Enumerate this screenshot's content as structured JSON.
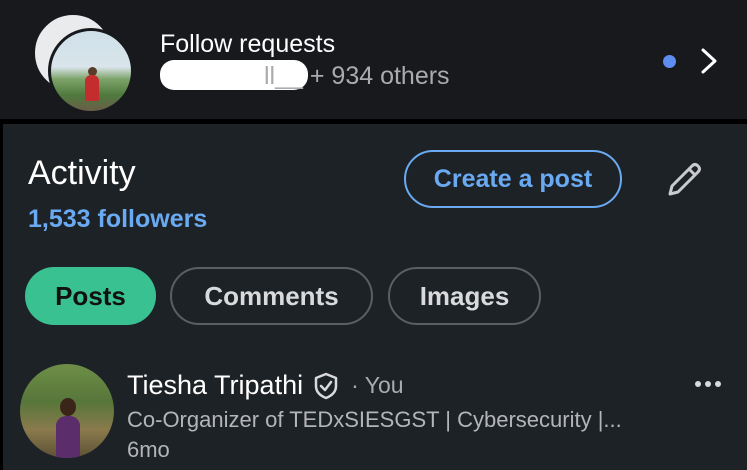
{
  "follow_requests": {
    "title": "Follow requests",
    "name_fragment": "ll__",
    "others_text": " + 934 others",
    "dot_color": "#5e8df0"
  },
  "activity": {
    "title": "Activity",
    "followers": "1,533 followers",
    "create_post_label": "Create a post",
    "edit_icon": "pencil-icon",
    "accent_color": "#6aaaf2"
  },
  "tabs": [
    {
      "label": "Posts",
      "selected": true
    },
    {
      "label": "Comments",
      "selected": false
    },
    {
      "label": "Images",
      "selected": false
    }
  ],
  "post": {
    "author": "Tiesha Tripathi",
    "separator": "·",
    "relation": "You",
    "headline": "Co-Organizer of TEDxSIESGST | Cybersecurity |...",
    "time": "6mo",
    "more_icon": "more-horizontal-icon"
  },
  "colors": {
    "selected_tab": "#3ac192",
    "background": "#1d2226"
  }
}
